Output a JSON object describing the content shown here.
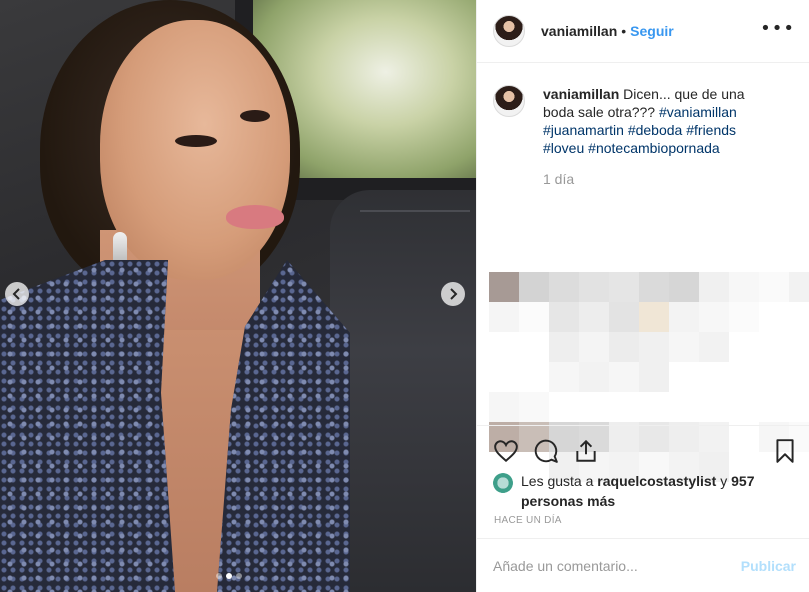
{
  "post": {
    "photo": {
      "icons": {
        "prev": "chevron-left-icon",
        "next": "chevron-right-icon"
      },
      "carousel": {
        "slides": 3,
        "active_slide": 2
      }
    },
    "header": {
      "username": "vaniamillan",
      "separator": "•",
      "follow_label": "Seguir",
      "more_label": "•••"
    },
    "caption": {
      "username": "vaniamillan",
      "text": "Dicen... que de una boda sale otra???",
      "hashtags": [
        "#vaniamillan",
        "#juanamartin",
        "#deboda",
        "#friends",
        "#loveu",
        "#notecambiopornada"
      ],
      "time_ago": "1 día"
    },
    "actions": {
      "icons": [
        "heart-icon",
        "comment-icon",
        "share-icon",
        "bookmark-icon"
      ]
    },
    "likes": {
      "prefix": "Les gusta a",
      "user": "raquelcostastylist",
      "conjunction": "y",
      "others": "957 personas más"
    },
    "date": "HACE UN DÍA",
    "comment_box": {
      "placeholder": "Añade un comentario...",
      "publish_label": "Publicar"
    },
    "colors": {
      "accent": "#3897f0",
      "hashtag": "#003569",
      "muted": "#999999",
      "publish_disabled": "#b2dffc"
    }
  }
}
